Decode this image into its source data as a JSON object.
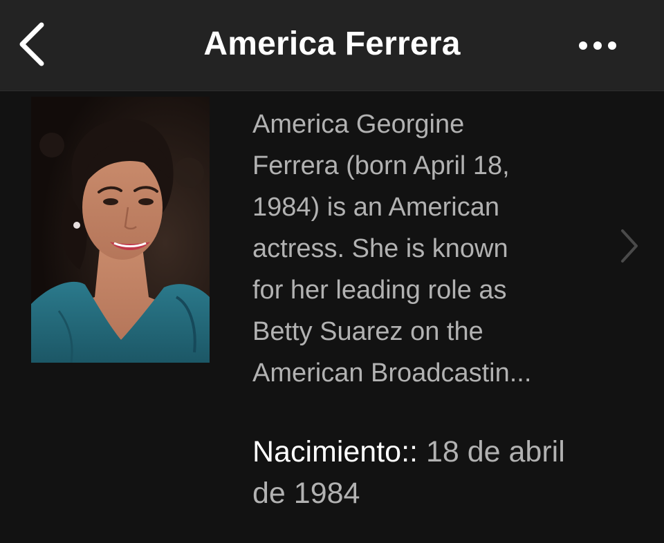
{
  "nav": {
    "title": "America Ferrera",
    "back_icon": "chevron-left-icon",
    "more_icon": "more-horizontal-icon"
  },
  "person": {
    "photo_alt": "America Ferrera",
    "bio_lines": [
      "America Georgine",
      "Ferrera (born April 18,",
      "1984) is an American",
      "actress. She is known",
      "for her leading role as",
      "Betty Suarez on the",
      "American Broadcastin..."
    ],
    "expand_icon": "chevron-right-icon",
    "birth": {
      "label": "Nacimiento::",
      "value_line1": "18 de abril",
      "value_line2": "de 1984"
    }
  },
  "colors": {
    "background": "#121212",
    "navbar": "#232323",
    "title_text": "#ffffff",
    "body_text": "#b2b2b2",
    "chevron": "#4a4a4a"
  }
}
